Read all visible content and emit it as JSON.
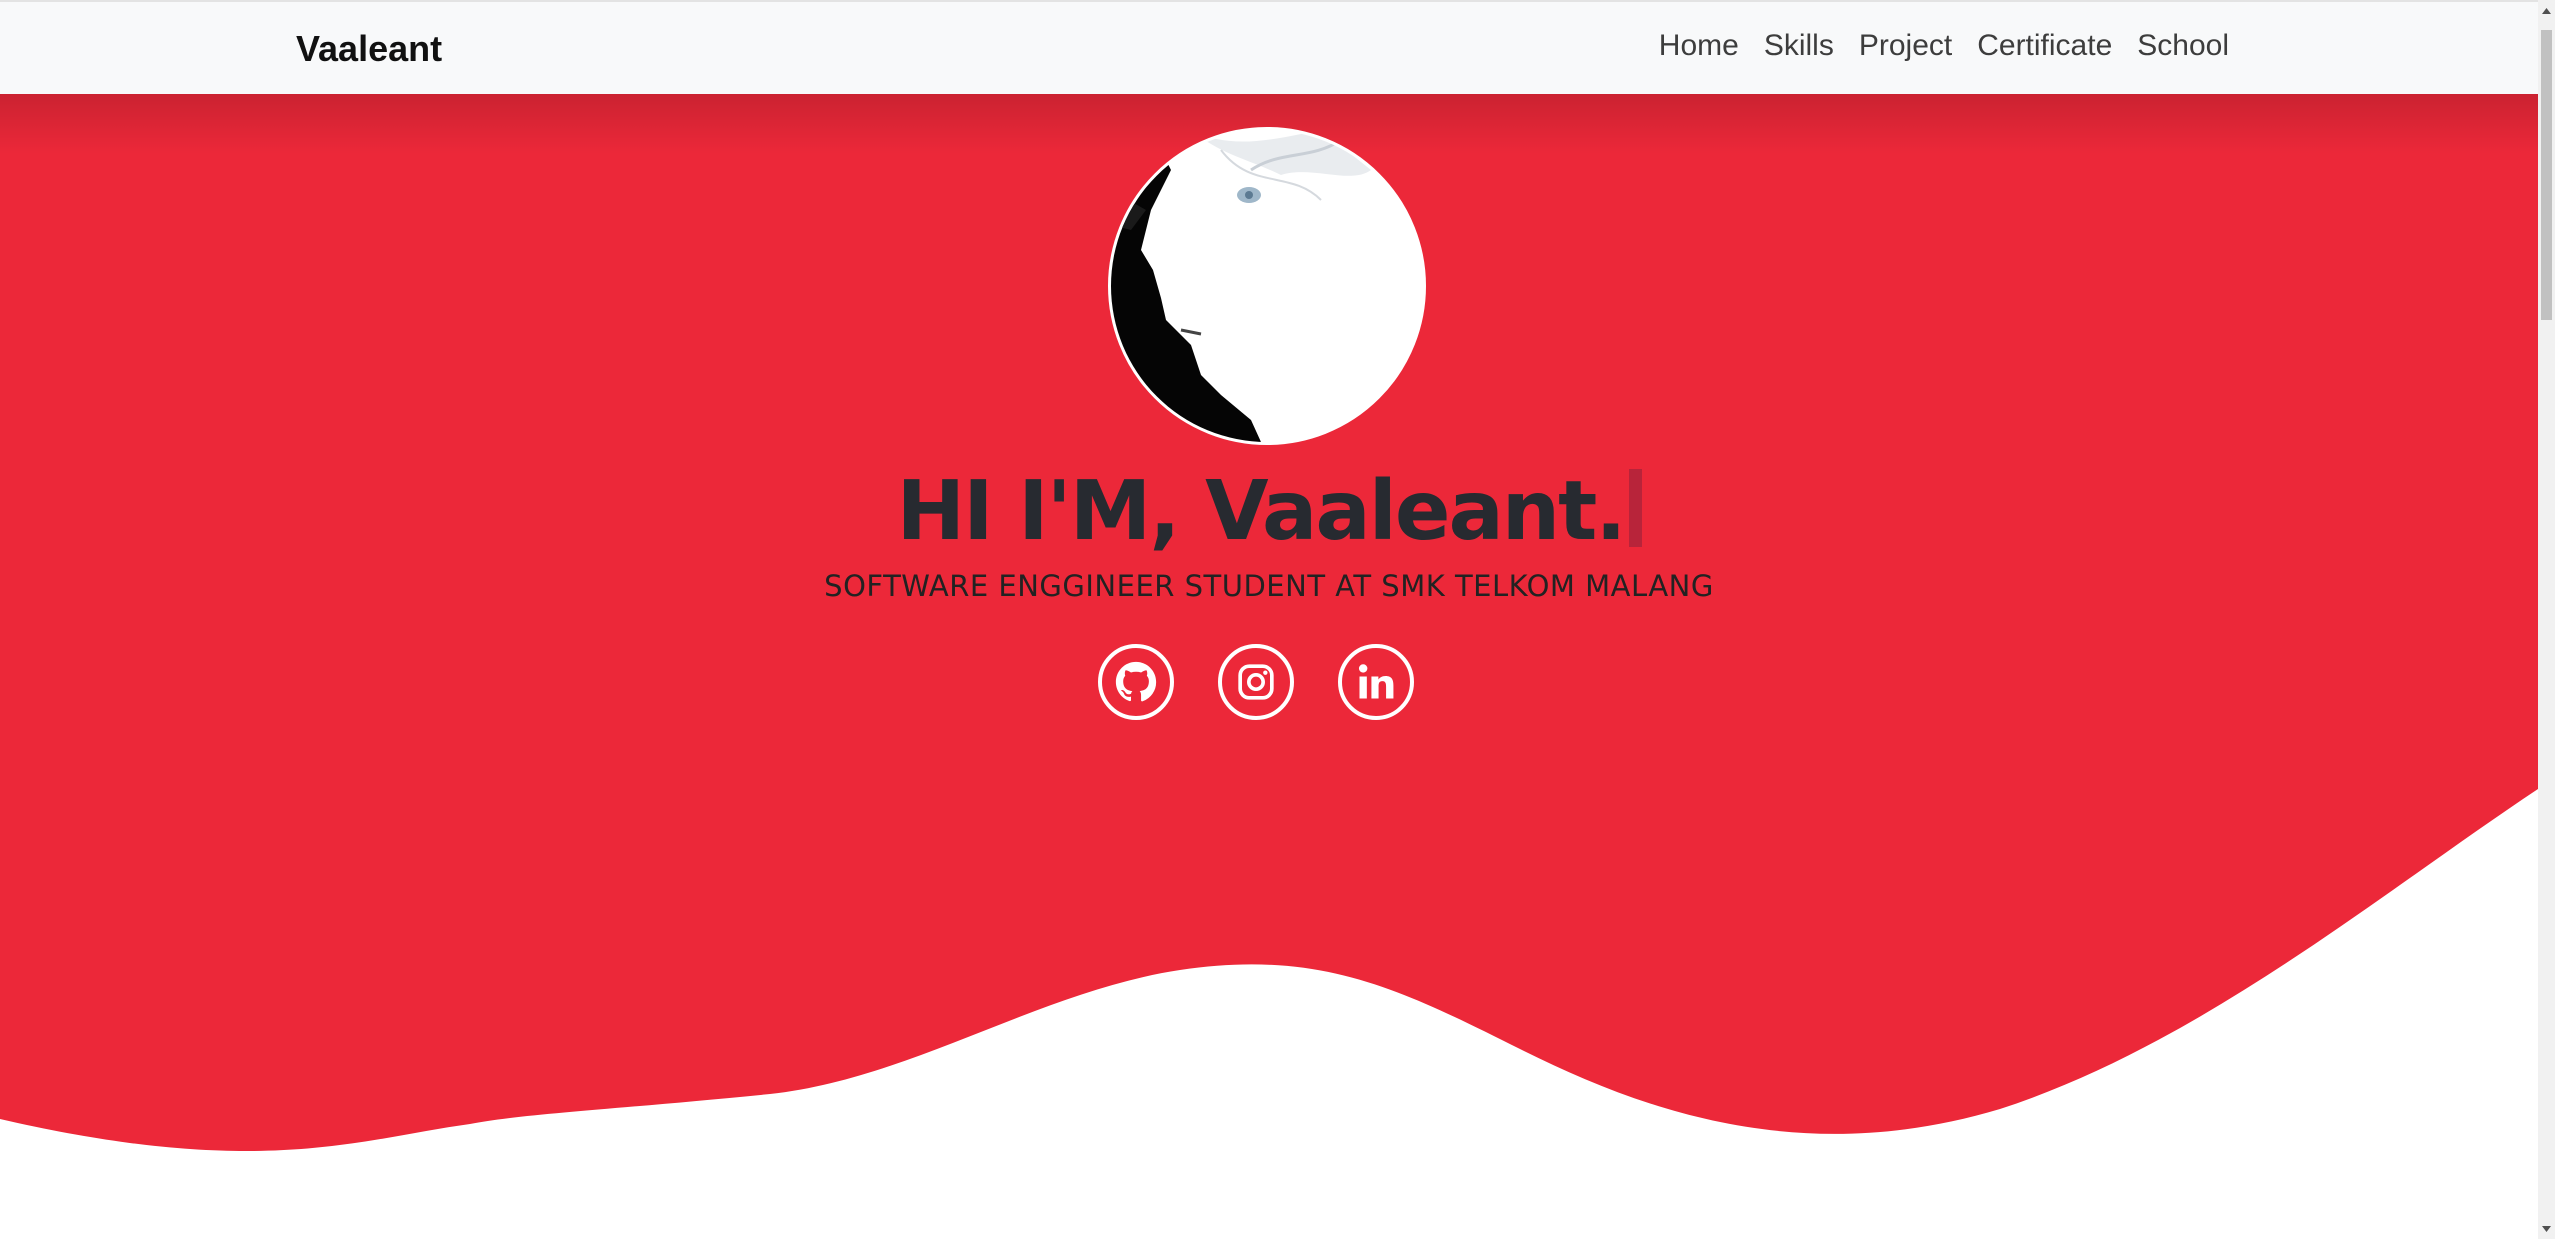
{
  "navbar": {
    "brand": "Vaaleant",
    "links": [
      "Home",
      "Skills",
      "Project",
      "Certificate",
      "School"
    ]
  },
  "hero": {
    "headline": "HI I'M, Vaaleant.",
    "subtitle": "SOFTWARE ENGGINEER STUDENT AT SMK TELKOM MALANG",
    "socials": [
      {
        "icon": "github-icon"
      },
      {
        "icon": "instagram-icon"
      },
      {
        "icon": "linkedin-icon"
      }
    ]
  },
  "colors": {
    "accent": "#ec2839",
    "navbar_bg": "#f8f9fa",
    "headline": "#272a30",
    "cursor": "#b8243a"
  }
}
